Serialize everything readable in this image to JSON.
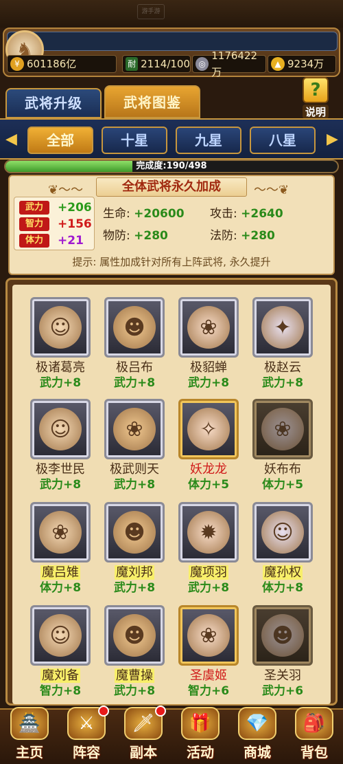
{
  "watermark": "游手游",
  "resources": {
    "gold": "601186亿",
    "stamina_icon": "耐",
    "stamina": "2114/100",
    "silver": "1176422万",
    "ingot": "9234万"
  },
  "main_tabs": [
    "武将升级",
    "武将图鉴"
  ],
  "help_label": "说明",
  "star_tabs": [
    "全部",
    "十星",
    "九星",
    "八星"
  ],
  "progress": {
    "label": "完成度:190/498",
    "fraction": 0.3815
  },
  "bonus": {
    "title": "全体武将永久加成",
    "core": [
      {
        "label": "武力",
        "value": "+206",
        "color": "#2a9a1a"
      },
      {
        "label": "智力",
        "value": "+156",
        "color": "#d01a1a"
      },
      {
        "label": "体力",
        "value": "+21",
        "color": "#a01ad0"
      }
    ],
    "stats": [
      {
        "label": "生命:",
        "value": "+20600"
      },
      {
        "label": "攻击:",
        "value": "+2640"
      },
      {
        "label": "物防:",
        "value": "+280"
      },
      {
        "label": "法防:",
        "value": "+280"
      }
    ],
    "hint": "提示: 属性加成针对所有上阵武将, 永久提升"
  },
  "heroes": [
    {
      "name": "极诸葛亮",
      "bonus": "武力+8",
      "frame": "silver",
      "style": "plain"
    },
    {
      "name": "极吕布",
      "bonus": "武力+8",
      "frame": "silver",
      "style": "plain"
    },
    {
      "name": "极貂蝉",
      "bonus": "武力+8",
      "frame": "silver",
      "style": "plain"
    },
    {
      "name": "极赵云",
      "bonus": "武力+8",
      "frame": "silver",
      "style": "plain"
    },
    {
      "name": "极李世民",
      "bonus": "武力+8",
      "frame": "silver",
      "style": "plain"
    },
    {
      "name": "极武则天",
      "bonus": "武力+8",
      "frame": "silver",
      "style": "plain"
    },
    {
      "name": "妖龙龙",
      "bonus": "体力+5",
      "frame": "gold",
      "style": "red"
    },
    {
      "name": "妖布布",
      "bonus": "体力+5",
      "frame": "dark",
      "style": "plain"
    },
    {
      "name": "魔吕雉",
      "bonus": "体力+8",
      "frame": "silver",
      "style": "hl"
    },
    {
      "name": "魔刘邦",
      "bonus": "武力+8",
      "frame": "silver",
      "style": "hl"
    },
    {
      "name": "魔项羽",
      "bonus": "武力+8",
      "frame": "silver",
      "style": "hl"
    },
    {
      "name": "魔孙权",
      "bonus": "体力+8",
      "frame": "silver",
      "style": "hl"
    },
    {
      "name": "魔刘备",
      "bonus": "智力+8",
      "frame": "silver",
      "style": "hl"
    },
    {
      "name": "魔曹操",
      "bonus": "武力+8",
      "frame": "silver",
      "style": "hl"
    },
    {
      "name": "圣虞姬",
      "bonus": "智力+6",
      "frame": "gold",
      "style": "red"
    },
    {
      "name": "圣关羽",
      "bonus": "武力+6",
      "frame": "dark",
      "style": "plain"
    }
  ],
  "nav": [
    {
      "label": "主页",
      "icon": "🏯",
      "dot": false
    },
    {
      "label": "阵容",
      "icon": "⚔",
      "dot": true
    },
    {
      "label": "副本",
      "icon": "🗡",
      "dot": true
    },
    {
      "label": "活动",
      "icon": "🎁",
      "dot": false
    },
    {
      "label": "商城",
      "icon": "💎",
      "dot": false
    },
    {
      "label": "背包",
      "icon": "🎒",
      "dot": false
    }
  ]
}
